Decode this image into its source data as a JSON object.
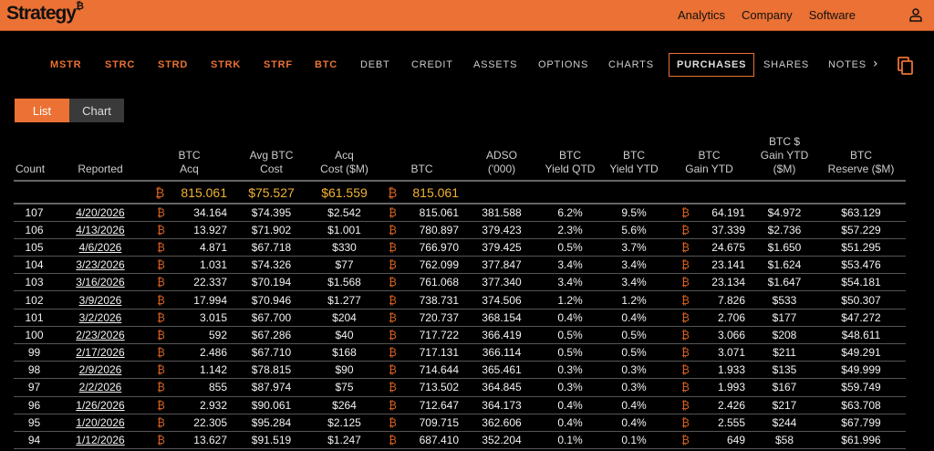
{
  "header": {
    "logo": "Strategy₿",
    "links": [
      "Analytics",
      "Company",
      "Software"
    ],
    "user_icon": "user-icon",
    "accent": "#EB7134"
  },
  "nav": {
    "items": [
      {
        "label": "MSTR",
        "type": "ticker"
      },
      {
        "label": "STRC",
        "type": "ticker"
      },
      {
        "label": "STRD",
        "type": "ticker"
      },
      {
        "label": "STRK",
        "type": "ticker"
      },
      {
        "label": "STRF",
        "type": "ticker"
      },
      {
        "label": "BTC",
        "type": "ticker"
      },
      {
        "label": "DEBT"
      },
      {
        "label": "CREDIT"
      },
      {
        "label": "ASSETS"
      },
      {
        "label": "OPTIONS"
      },
      {
        "label": "CHARTS"
      },
      {
        "label": "PURCHASES",
        "active": true
      },
      {
        "label": "SHARES"
      },
      {
        "label": "NOTES"
      }
    ],
    "more": "›",
    "copy_icon": "copy-icon"
  },
  "view_toggle": {
    "list": "List",
    "chart": "Chart",
    "selected": "List"
  },
  "table": {
    "btc_symbol": "₿",
    "headers": [
      [
        "",
        "Count"
      ],
      [
        "",
        "Reported"
      ],
      [
        "BTC",
        "Acq"
      ],
      [
        "Avg BTC",
        "Cost"
      ],
      [
        "Acq",
        "Cost ($M)"
      ],
      [
        "",
        "BTC"
      ],
      [
        "ADSO",
        "('000)"
      ],
      [
        "BTC",
        "Yield QTD"
      ],
      [
        "BTC",
        "Yield YTD"
      ],
      [
        "BTC",
        "Gain YTD"
      ],
      [
        "BTC $",
        "Gain YTD",
        "($M)"
      ],
      [
        "BTC",
        "Reserve ($M)"
      ]
    ],
    "summary": {
      "btc_acq": "815.061",
      "avg_cost": "$75.527",
      "acq_cost": "$61.559",
      "btc": "815.061"
    },
    "rows": [
      [
        "107",
        "4/20/2026",
        "34.164",
        "$74.395",
        "$2.542",
        "815.061",
        "381.588",
        "6.2%",
        "9.5%",
        "64.191",
        "$4.972",
        "$63.129"
      ],
      [
        "106",
        "4/13/2026",
        "13.927",
        "$71.902",
        "$1.001",
        "780.897",
        "379.423",
        "2.3%",
        "5.6%",
        "37.339",
        "$2.736",
        "$57.229"
      ],
      [
        "105",
        "4/6/2026",
        "4.871",
        "$67.718",
        "$330",
        "766.970",
        "379.425",
        "0.5%",
        "3.7%",
        "24.675",
        "$1.650",
        "$51.295"
      ],
      [
        "104",
        "3/23/2026",
        "1.031",
        "$74.326",
        "$77",
        "762.099",
        "377.847",
        "3.4%",
        "3.4%",
        "23.141",
        "$1.624",
        "$53.476"
      ],
      [
        "103",
        "3/16/2026",
        "22.337",
        "$70.194",
        "$1.568",
        "761.068",
        "377.340",
        "3.4%",
        "3.4%",
        "23.134",
        "$1.647",
        "$54.181"
      ],
      [
        "102",
        "3/9/2026",
        "17.994",
        "$70.946",
        "$1.277",
        "738.731",
        "374.506",
        "1.2%",
        "1.2%",
        "7.826",
        "$533",
        "$50.307"
      ],
      [
        "101",
        "3/2/2026",
        "3.015",
        "$67.700",
        "$204",
        "720.737",
        "368.154",
        "0.4%",
        "0.4%",
        "2.706",
        "$177",
        "$47.272"
      ],
      [
        "100",
        "2/23/2026",
        "592",
        "$67.286",
        "$40",
        "717.722",
        "366.419",
        "0.5%",
        "0.5%",
        "3.066",
        "$208",
        "$48.611"
      ],
      [
        "99",
        "2/17/2026",
        "2.486",
        "$67.710",
        "$168",
        "717.131",
        "366.114",
        "0.5%",
        "0.5%",
        "3.071",
        "$211",
        "$49.291"
      ],
      [
        "98",
        "2/9/2026",
        "1.142",
        "$78.815",
        "$90",
        "714.644",
        "365.461",
        "0.3%",
        "0.3%",
        "1.933",
        "$135",
        "$49.999"
      ],
      [
        "97",
        "2/2/2026",
        "855",
        "$87.974",
        "$75",
        "713.502",
        "364.845",
        "0.3%",
        "0.3%",
        "1.993",
        "$167",
        "$59.749"
      ],
      [
        "96",
        "1/26/2026",
        "2.932",
        "$90.061",
        "$264",
        "712.647",
        "364.173",
        "0.4%",
        "0.4%",
        "2.426",
        "$217",
        "$63.708"
      ],
      [
        "95",
        "1/20/2026",
        "22.305",
        "$95.284",
        "$2.125",
        "709.715",
        "362.606",
        "0.4%",
        "0.4%",
        "2.555",
        "$244",
        "$67.799"
      ],
      [
        "94",
        "1/12/2026",
        "13.627",
        "$91.519",
        "$1.247",
        "687.410",
        "352.204",
        "0.1%",
        "0.1%",
        "649",
        "$58",
        "$61.996"
      ]
    ]
  }
}
